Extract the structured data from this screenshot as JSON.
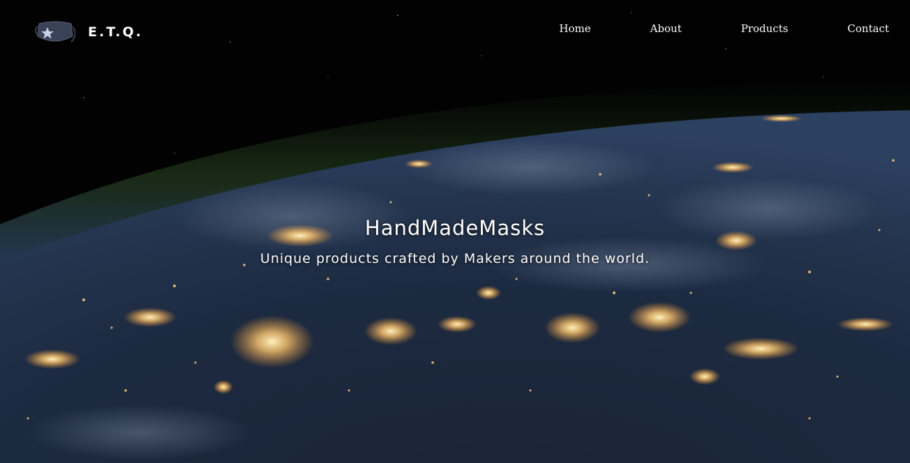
{
  "brand": {
    "name": "E.T.Q.",
    "logo_icon": "face-mask-star-icon"
  },
  "nav": {
    "items": [
      {
        "label": "Home"
      },
      {
        "label": "About"
      },
      {
        "label": "Products"
      },
      {
        "label": "Contact"
      }
    ]
  },
  "hero": {
    "title": "HandMadeMasks",
    "subtitle": "Unique products crafted by Makers around the world.",
    "background": "earth-at-night-from-space-image"
  },
  "colors": {
    "background": "#000000",
    "text": "#ffffff",
    "city_lights": "#ffcf7a",
    "atmosphere": "#3a5a2a"
  }
}
